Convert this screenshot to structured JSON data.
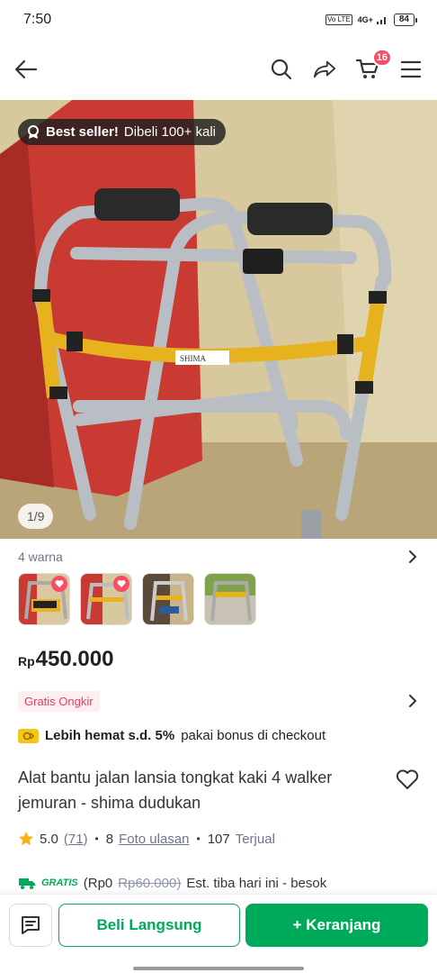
{
  "status_bar": {
    "time": "7:50",
    "network": "4G+",
    "sim_badge": "Vo LTE",
    "battery": "84"
  },
  "header": {
    "cart_count": "16",
    "icons": [
      "back-arrow-icon",
      "search-icon",
      "share-icon",
      "cart-icon",
      "menu-icon"
    ]
  },
  "product_image": {
    "badge_bold": "Best seller!",
    "badge_text": "Dibeli 100+ kali",
    "counter": "1/9",
    "brand_label": "SHIMA"
  },
  "variants": {
    "label": "4 warna",
    "count": 4
  },
  "price": {
    "currency": "Rp",
    "value": "450.000"
  },
  "shipping_badge": "Gratis Ongkir",
  "bonus": {
    "bold": "Lebih hemat s.d. 5%",
    "text": "pakai bonus di checkout"
  },
  "title": "Alat bantu jalan lansia tongkat kaki 4 walker jemuran - shima dudukan",
  "rating": {
    "score": "5.0",
    "reviews": "(71)",
    "photo_count": "8",
    "photo_label": "Foto ulasan",
    "sold_count": "107",
    "sold_label": "Terjual"
  },
  "shipping": {
    "gratis_label": "GRATIS",
    "price_now": "(Rp0",
    "price_old": "Rp60.000)",
    "eta": "Est. tiba hari ini - besok"
  },
  "actions": {
    "buy_now": "Beli Langsung",
    "add_cart": "+ Keranjang"
  },
  "colors": {
    "primary": "#00aa5b",
    "badge": "#f94d63",
    "ongkir_text": "#e0435a"
  }
}
